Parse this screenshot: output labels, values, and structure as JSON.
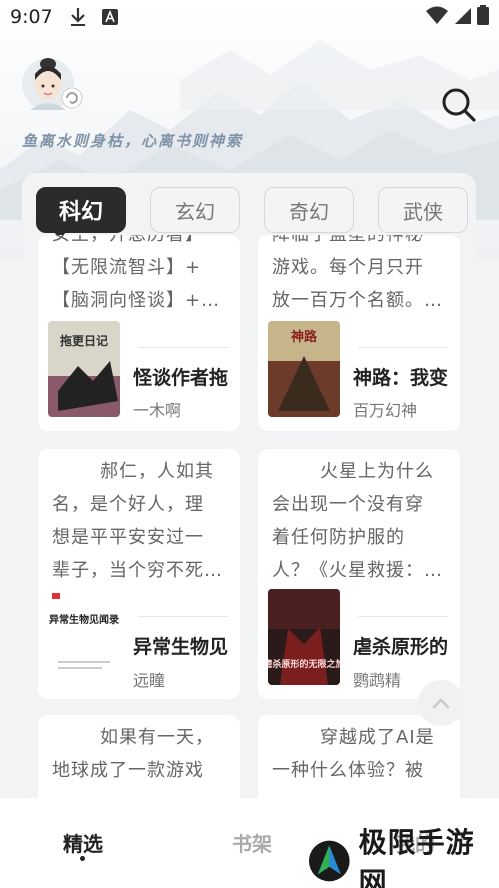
{
  "status_bar": {
    "time": "9:07"
  },
  "header": {
    "slogan": "鱼离水则身枯，心离书则神索"
  },
  "tabs": [
    {
      "label": "科幻",
      "active": true
    },
    {
      "label": "玄幻",
      "active": false
    },
    {
      "label": "奇幻",
      "active": false
    },
    {
      "label": "武侠",
      "active": false
    }
  ],
  "cards": [
    {
      "desc_lines": [
        "女主，开急历看】",
        "【无限流智斗】+",
        "【脑洞向怪谈】+…"
      ],
      "title": "怪谈作者拖",
      "author": "一木啊",
      "cover_text": "拖更日记"
    },
    {
      "desc_lines": [
        "降临了蓝星的神秘",
        "游戏。每个月只开",
        "放一百万个名额。…"
      ],
      "title": "神路：我变",
      "author": "百万幻神",
      "cover_text": "神路"
    },
    {
      "desc_lines": [
        "郝仁，人如其",
        "名，是个好人，理",
        "想是平平安安过一",
        "辈子，当个穷不死…"
      ],
      "title": "异常生物见",
      "author": "远瞳",
      "cover_text": "异常生物见闻录"
    },
    {
      "desc_lines": [
        "火星上为什么",
        "会出现一个没有穿",
        "着任何防护服的",
        "人？《火星救援：…"
      ],
      "title": "虐杀原形的",
      "author": "鹦鹉精",
      "cover_text": "虐杀原形的无限之旅"
    },
    {
      "desc_lines": [
        "如果有一天，",
        "地球成了一款游戏"
      ],
      "title": "",
      "author": ""
    },
    {
      "desc_lines": [
        "穿越成了AI是",
        "一种什么体验？被"
      ],
      "title": "",
      "author": ""
    }
  ],
  "bottom_nav": [
    {
      "label": "精选",
      "active": true
    },
    {
      "label": "书架",
      "active": false
    },
    {
      "label": "我的",
      "active": false
    }
  ],
  "watermark": {
    "text": "极限手游网"
  }
}
